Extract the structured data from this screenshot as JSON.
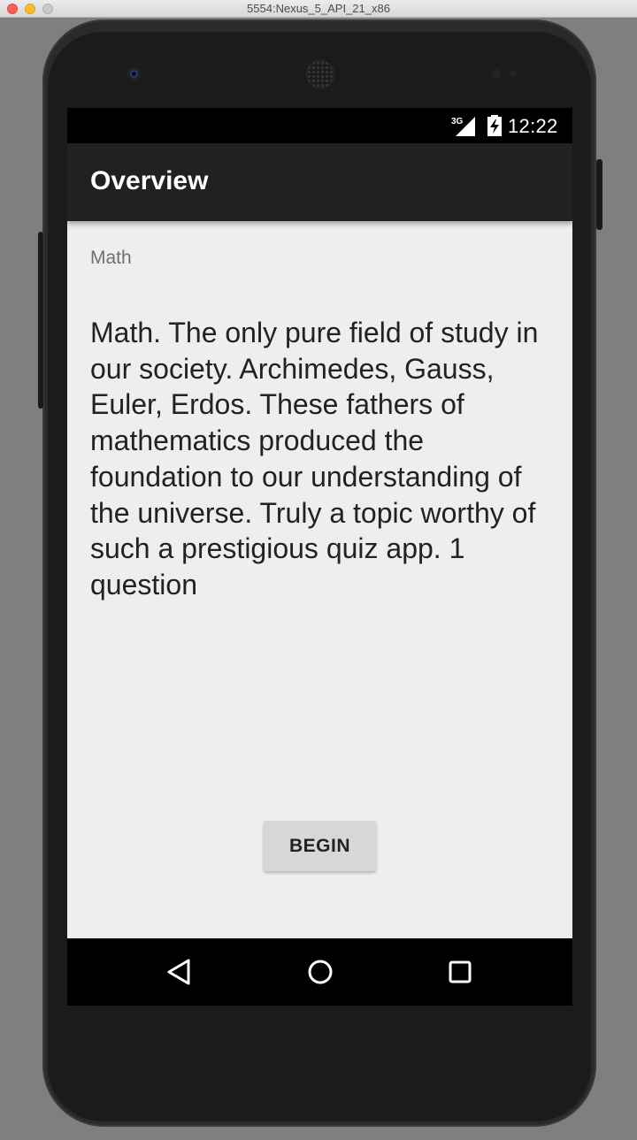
{
  "window": {
    "title": "5554:Nexus_5_API_21_x86"
  },
  "status_bar": {
    "network": "3G",
    "time": "12:22",
    "icons": [
      "signal-icon",
      "battery-charging-icon"
    ]
  },
  "app_bar": {
    "title": "Overview"
  },
  "content": {
    "category": "Math",
    "description": "Math. The only pure field of study in our society.  Archimedes, Gauss, Euler, Erdos.  These fathers of mathematics produced the foundation to our understanding of the universe. Truly a topic worthy of such a prestigious quiz app. 1 question",
    "begin_label": "BEGIN"
  },
  "nav_bar": {
    "icons": [
      "back-icon",
      "home-icon",
      "recents-icon"
    ]
  },
  "colors": {
    "app_bar": "#212121",
    "screen_bg": "#eeeeee",
    "button_bg": "#d6d7d7",
    "status_bar": "#000000"
  }
}
